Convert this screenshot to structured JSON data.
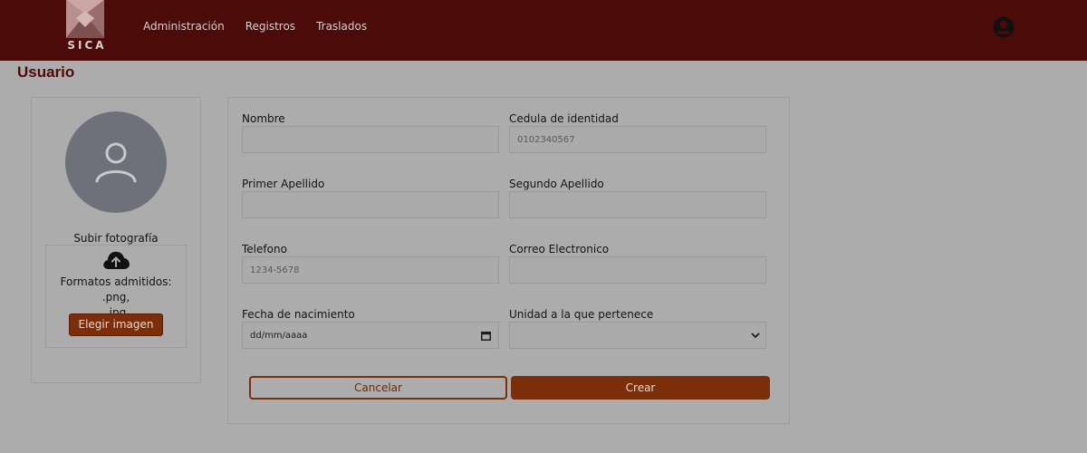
{
  "app": {
    "logo_text": "SICA"
  },
  "nav": {
    "items": [
      {
        "label": "Administración"
      },
      {
        "label": "Registros"
      },
      {
        "label": "Traslados"
      }
    ]
  },
  "page": {
    "title": "Usuario"
  },
  "photo": {
    "upload_title": "Subir fotografía",
    "formats_line1": "Formatos admitidos: .png,",
    "formats_line2": ".jpg",
    "choose_label": "Elegir imagen"
  },
  "form": {
    "nombre": {
      "label": "Nombre",
      "value": ""
    },
    "cedula": {
      "label": "Cedula de identidad",
      "placeholder": "0102340567"
    },
    "primer_apellido": {
      "label": "Primer Apellido",
      "value": ""
    },
    "segundo_apellido": {
      "label": "Segundo Apellido",
      "value": ""
    },
    "telefono": {
      "label": "Telefono",
      "placeholder": "1234-5678"
    },
    "correo": {
      "label": "Correo Electronico",
      "value": ""
    },
    "fecha": {
      "label": "Fecha de nacimiento",
      "value": "dd/mm/aaaa"
    },
    "unidad": {
      "label": "Unidad a la que pertenece",
      "value": ""
    },
    "cancel_label": "Cancelar",
    "create_label": "Crear"
  },
  "colors": {
    "header": "#4a0b09",
    "accent": "#7a2e0a",
    "overlay_background": "#acacac"
  },
  "icons": [
    "logo-mark-icon",
    "account-icon",
    "user-icon",
    "cloud-upload-icon",
    "calendar-icon",
    "chevron-down-icon"
  ]
}
